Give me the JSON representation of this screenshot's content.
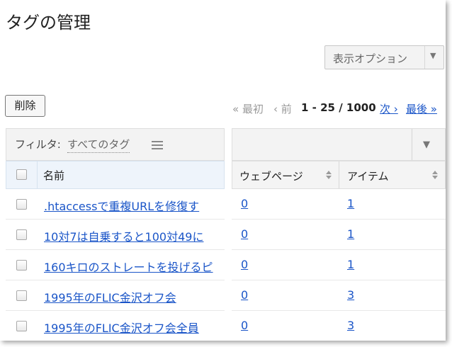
{
  "page": {
    "title": "タグの管理"
  },
  "toolbar": {
    "display_options_label": "表示オプション",
    "dropdown_arrow": "▼",
    "delete_label": "削除"
  },
  "pager": {
    "first": "« 最初",
    "prev": "‹ 前",
    "range": "1 - 25 / 1000",
    "next": "次 ›",
    "last": "最後 »"
  },
  "filter": {
    "label": "フィルタ:",
    "value": "すべてのタグ",
    "icon": "list-icon"
  },
  "table": {
    "columns": {
      "name": "名前",
      "webpages": "ウェブページ",
      "items": "アイテム"
    },
    "rows": [
      {
        "name": ".htaccessで重複URLを修復す",
        "webpages": "0",
        "items": "1"
      },
      {
        "name": "10対7は自乗すると100対49に",
        "webpages": "0",
        "items": "1"
      },
      {
        "name": "160キロのストレートを投げるピ",
        "webpages": "0",
        "items": "1"
      },
      {
        "name": "1995年のFLIC金沢オフ会",
        "webpages": "0",
        "items": "3"
      },
      {
        "name": "1995年のFLIC金沢オフ会全員",
        "webpages": "0",
        "items": "3"
      }
    ]
  }
}
